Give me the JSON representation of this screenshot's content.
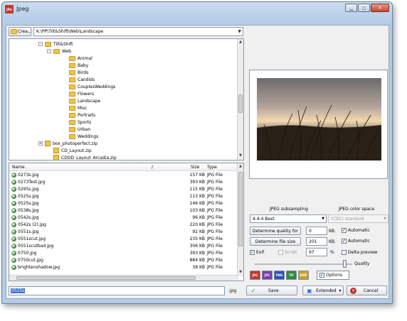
{
  "window": {
    "title": "Jpeg",
    "app_icon": "JPG",
    "controls": {
      "minimize": "▁",
      "maximize": "▢",
      "close": "✕"
    }
  },
  "pathbar": {
    "create_label": "Crea...",
    "path": "K:\\PP\\Tilt&Shift\\Web\\Landscape"
  },
  "tree": {
    "items": [
      {
        "label": "Tilt&Shift",
        "expander": "-"
      },
      {
        "label": "Web",
        "expander": "-"
      },
      {
        "label": "Animal"
      },
      {
        "label": "Baby"
      },
      {
        "label": "Birds"
      },
      {
        "label": "Candids"
      },
      {
        "label": "CouplesWeddings"
      },
      {
        "label": "Flowers"
      },
      {
        "label": "Landscape"
      },
      {
        "label": "Misc"
      },
      {
        "label": "Portraits"
      },
      {
        "label": "Sports"
      },
      {
        "label": "Urban"
      },
      {
        "label": "Weddings"
      },
      {
        "label": "box_photoperfect.zip",
        "expander": "+"
      },
      {
        "label": "CD_Layout.zip"
      },
      {
        "label": "CDOD_Layout_Arcadia.zip"
      }
    ]
  },
  "filelist": {
    "columns": {
      "name": "Name",
      "sort_mark": "/",
      "size": "Size",
      "type": "Type"
    },
    "rows": [
      {
        "name": "0273s.jpg",
        "size": "157 KB",
        "type": "JPG File"
      },
      {
        "name": "0273Test.jpg",
        "size": "393 KB",
        "type": "JPG File"
      },
      {
        "name": "0295s.jpg",
        "size": "115 KB",
        "type": "JPG File"
      },
      {
        "name": "0525s.jpg",
        "size": "113 KB",
        "type": "JPG File"
      },
      {
        "name": "0525s.jpg",
        "size": "146 KB",
        "type": "JPG File"
      },
      {
        "name": "0538s.jpg",
        "size": "103 KB",
        "type": "JPG File"
      },
      {
        "name": "0542s.jpg",
        "size": "96 KB",
        "type": "JPG File"
      },
      {
        "name": "0542s (2).jpg",
        "size": "220 KB",
        "type": "JPG File"
      },
      {
        "name": "0551s.jpg",
        "size": "92 KB",
        "type": "JPG File"
      },
      {
        "name": "0551scut.jpg",
        "size": "235 KB",
        "type": "JPG File"
      },
      {
        "name": "0551scutbad.jpg",
        "size": "306 KB",
        "type": "JPG File"
      },
      {
        "name": "0750.jpg",
        "size": "393 KB",
        "type": "JPG File"
      },
      {
        "name": "0750cut.jpg",
        "size": "884 KB",
        "type": "JPG File"
      },
      {
        "name": "brightenshadow.jpg",
        "size": "38 KB",
        "type": "JPG File"
      }
    ]
  },
  "options": {
    "subsampling_label": "JPEG subsampling",
    "colorspace_label": "JPEG color space",
    "subsampling_value": "4:4:4 Best",
    "colorspace_value": "YCbCr standard",
    "determine_quality_label": "Determine quality for",
    "quality_target_value": "0",
    "quality_unit": "KB.",
    "auto1_label": "Automatic",
    "determine_size_label": "Determine file size",
    "file_size_value": "201",
    "size_unit": "KB.",
    "auto2_label": "Automatic",
    "exif_label": "Exif",
    "script_label": "Script",
    "quality_value": "97",
    "percent": "%",
    "delta_label": "Delta preview",
    "quality_label": "Quality",
    "quality_slider": 0.95,
    "check_mark": "✓"
  },
  "format_tabs": [
    {
      "label": "JPG",
      "color": "#c0392b"
    },
    {
      "label": "JP2",
      "color": "#7b3fa8"
    },
    {
      "label": "PNG",
      "color": "#3050b8"
    },
    {
      "label": "TIF",
      "color": "#2e8b3c"
    },
    {
      "label": "BMP",
      "color": "#c8a020"
    }
  ],
  "options_tab_label": "Options",
  "bottom": {
    "filename": "0525s",
    "extension": ".jpg",
    "save_label": "Save",
    "extended_label": "Extended",
    "cancel_label": "Cancel",
    "save_icon": "✓",
    "cancel_icon": "✕",
    "dropdown_icon": "▾"
  }
}
